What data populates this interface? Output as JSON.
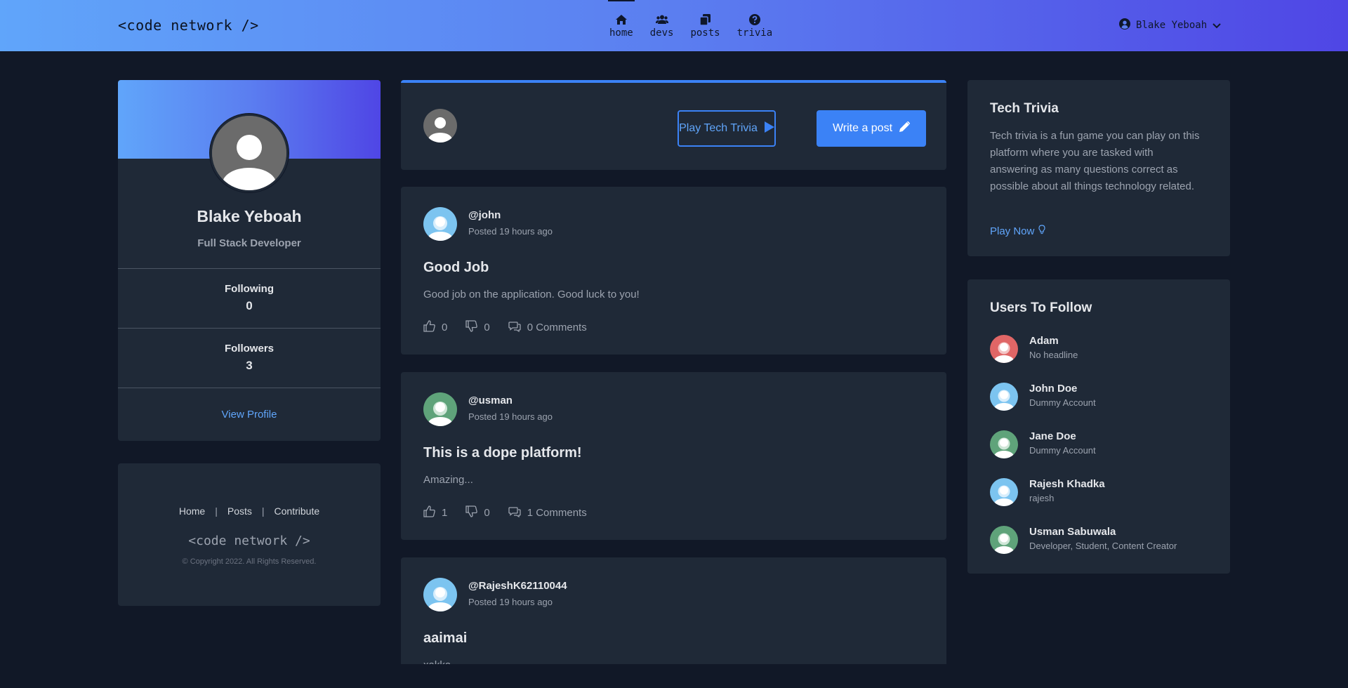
{
  "brand": "<code network />",
  "nav": {
    "items": [
      {
        "label": "home",
        "icon": "home-icon",
        "active": true
      },
      {
        "label": "devs",
        "icon": "users-icon",
        "active": false
      },
      {
        "label": "posts",
        "icon": "copy-icon",
        "active": false
      },
      {
        "label": "trivia",
        "icon": "question-circle-icon",
        "active": false
      }
    ],
    "user": "Blake Yeboah"
  },
  "profile": {
    "name": "Blake Yeboah",
    "role": "Full Stack Developer",
    "following_label": "Following",
    "following": "0",
    "followers_label": "Followers",
    "followers": "3",
    "view_link": "View Profile"
  },
  "footer": {
    "links": [
      "Home",
      "Posts",
      "Contribute"
    ],
    "brand": "<code network />",
    "copyright": "© Copyright 2022. All Rights Reserved."
  },
  "composer": {
    "trivia_button": "Play Tech Trivia",
    "write_button": "Write a post"
  },
  "posts": [
    {
      "author": "@john",
      "time": "Posted 19 hours ago",
      "title": "Good Job",
      "body": "Good job on the application. Good luck to you!",
      "likes": "0",
      "dislikes": "0",
      "comments": "0 Comments",
      "avatar_color": "#7cc4f0"
    },
    {
      "author": "@usman",
      "time": "Posted 19 hours ago",
      "title": "This is a dope platform!",
      "body": "Amazing...",
      "likes": "1",
      "dislikes": "0",
      "comments": "1 Comments",
      "avatar_color": "#5fa37a"
    },
    {
      "author": "@RajeshK62110044",
      "time": "Posted 19 hours ago",
      "title": "aaimai",
      "body": "xakka",
      "avatar_color": "#7cc4f0"
    }
  ],
  "trivia": {
    "title": "Tech Trivia",
    "description": "Tech trivia is a fun game you can play on this platform where you are tasked with answering as many questions correct as possible about all things technology related.",
    "play": "Play Now"
  },
  "follow": {
    "title": "Users To Follow",
    "users": [
      {
        "name": "Adam",
        "headline": "No headline",
        "color": "#e06666"
      },
      {
        "name": "John Doe",
        "headline": "Dummy Account",
        "color": "#7cc4f0"
      },
      {
        "name": "Jane Doe",
        "headline": "Dummy Account",
        "color": "#5fa37a"
      },
      {
        "name": "Rajesh Khadka",
        "headline": "rajesh",
        "color": "#7cc4f0"
      },
      {
        "name": "Usman Sabuwala",
        "headline": "Developer, Student, Content Creator",
        "color": "#5fa37a"
      }
    ]
  },
  "colors": {
    "accent": "#3b82f6",
    "bg": "#111827",
    "card": "#1f2937"
  }
}
